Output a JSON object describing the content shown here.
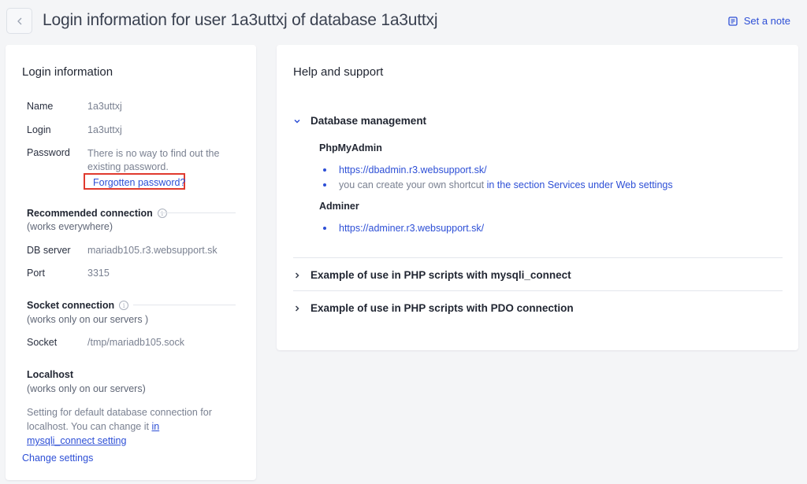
{
  "header": {
    "back_icon": "chevron-left-icon",
    "title": "Login information for user 1a3uttxj of database 1a3uttxj",
    "set_note_label": "Set a note",
    "set_note_icon": "note-icon"
  },
  "login_card": {
    "title": "Login information",
    "name": {
      "label": "Name",
      "value": "1a3uttxj"
    },
    "login": {
      "label": "Login",
      "value": "1a3uttxj"
    },
    "password": {
      "label": "Password",
      "value": "There is no way to find out the existing password.",
      "forgot_link": "Forgotten password?"
    },
    "recommended": {
      "title": "Recommended connection",
      "subtitle": "(works everywhere)",
      "db_server": {
        "label": "DB server",
        "value": "mariadb105.r3.websupport.sk"
      },
      "port": {
        "label": "Port",
        "value": "3315"
      }
    },
    "socket": {
      "title": "Socket connection",
      "subtitle": "(works only on our servers )",
      "socket": {
        "label": "Socket",
        "value": "/tmp/mariadb105.sock"
      }
    },
    "localhost": {
      "title": "Localhost",
      "subtitle": "(works only on our servers)",
      "desc_prefix": "Setting for default database connection for localhost. You can change it ",
      "desc_link": "in mysqli_connect setting",
      "change_settings": "Change settings"
    }
  },
  "help_card": {
    "title": "Help and support",
    "sections": [
      {
        "title": "Database management",
        "expanded": true
      },
      {
        "title": "Example of use in PHP scripts with mysqli_connect",
        "expanded": false
      },
      {
        "title": "Example of use in PHP scripts with PDO connection",
        "expanded": false
      }
    ],
    "phpmyadmin": {
      "title": "PhpMyAdmin",
      "url": "https://dbadmin.r3.websupport.sk/",
      "shortcut_prefix": "you can create your own shortcut ",
      "shortcut_link": "in the section Services under Web settings"
    },
    "adminer": {
      "title": "Adminer",
      "url": "https://adminer.r3.websupport.sk/"
    }
  },
  "colors": {
    "accent": "#2d4fd6",
    "highlight_border": "#e03a2e",
    "background": "#f4f5f7"
  }
}
